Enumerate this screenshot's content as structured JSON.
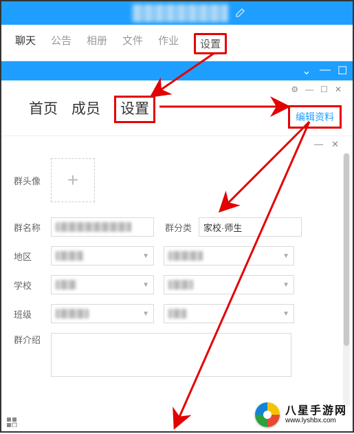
{
  "topbar": {
    "edit_icon": "pencil-icon"
  },
  "nav": {
    "chat": "聊天",
    "announce": "公告",
    "album": "相册",
    "files": "文件",
    "homework": "作业",
    "settings": "设置"
  },
  "window_ctrl": {
    "dropdown": "⌄",
    "min": "—",
    "max": "☐",
    "close": "✕"
  },
  "page": {
    "home": "首页",
    "members": "成员",
    "settings": "设置",
    "edit_link": "编辑资料",
    "gear": "⚙",
    "min": "—",
    "max": "☐",
    "close": "✕"
  },
  "form": {
    "avatar_label": "群头像",
    "avatar_plus": "+",
    "name_label": "群名称",
    "category_label": "群分类",
    "category_value": "家校·师生",
    "region_label": "地区",
    "school_label": "学校",
    "class_label": "班级",
    "intro_label": "群介绍",
    "dash": "—",
    "close": "✕"
  },
  "watermark": {
    "cn": "八星手游网",
    "url": "www.lyshbx.com"
  }
}
